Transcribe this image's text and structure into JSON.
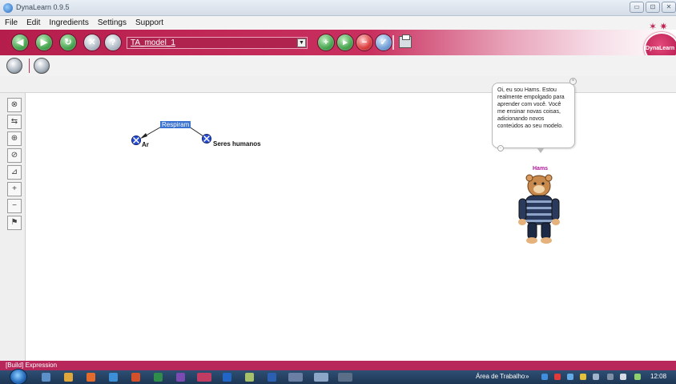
{
  "window": {
    "title": "DynaLearn 0.9.5",
    "controls": [
      "▭",
      "⊡",
      "✕"
    ]
  },
  "menu": [
    "File",
    "Edit",
    "Ingredients",
    "Settings",
    "Support"
  ],
  "toolbar": {
    "model_name": "TA_model_1",
    "left_buttons": [
      "back-icon",
      "forward-icon",
      "refresh-icon",
      "stop-icon",
      "help-icon"
    ],
    "right_buttons": [
      "add-model-icon",
      "run-model-icon",
      "delete-model-icon",
      "check-model-icon"
    ],
    "print_icon": "print-icon"
  },
  "logo": {
    "text": "DynaLearn",
    "color": "#c0224f"
  },
  "toolbar2": [
    "model-tool-icon",
    "ingredient-tool-icon"
  ],
  "left_tools": [
    "entity-tool",
    "configuration-tool",
    "attribute-tool",
    "quantity-tool",
    "value-tool",
    "add-tool",
    "remove-tool",
    "flag-tool"
  ],
  "diagram": {
    "relation_label": "Respiram",
    "entities": [
      {
        "label": "Ar"
      },
      {
        "label": "Seres humanos"
      }
    ]
  },
  "character": {
    "name": "Hams",
    "speech": "Oi, eu sou Hams. Estou realmente empolgado para aprender com você. Você me ensinar novas coisas, adicionando novos conteúdos ao seu modelo."
  },
  "status": {
    "text": "[Build] Expression"
  },
  "taskbar": {
    "tray_label": "Área de Trabalho",
    "tray_arrows": "»",
    "time": "12:08"
  },
  "colors": {
    "brand": "#b51d4c",
    "selection": "#3b73d1",
    "character_name": "#b0189a"
  }
}
